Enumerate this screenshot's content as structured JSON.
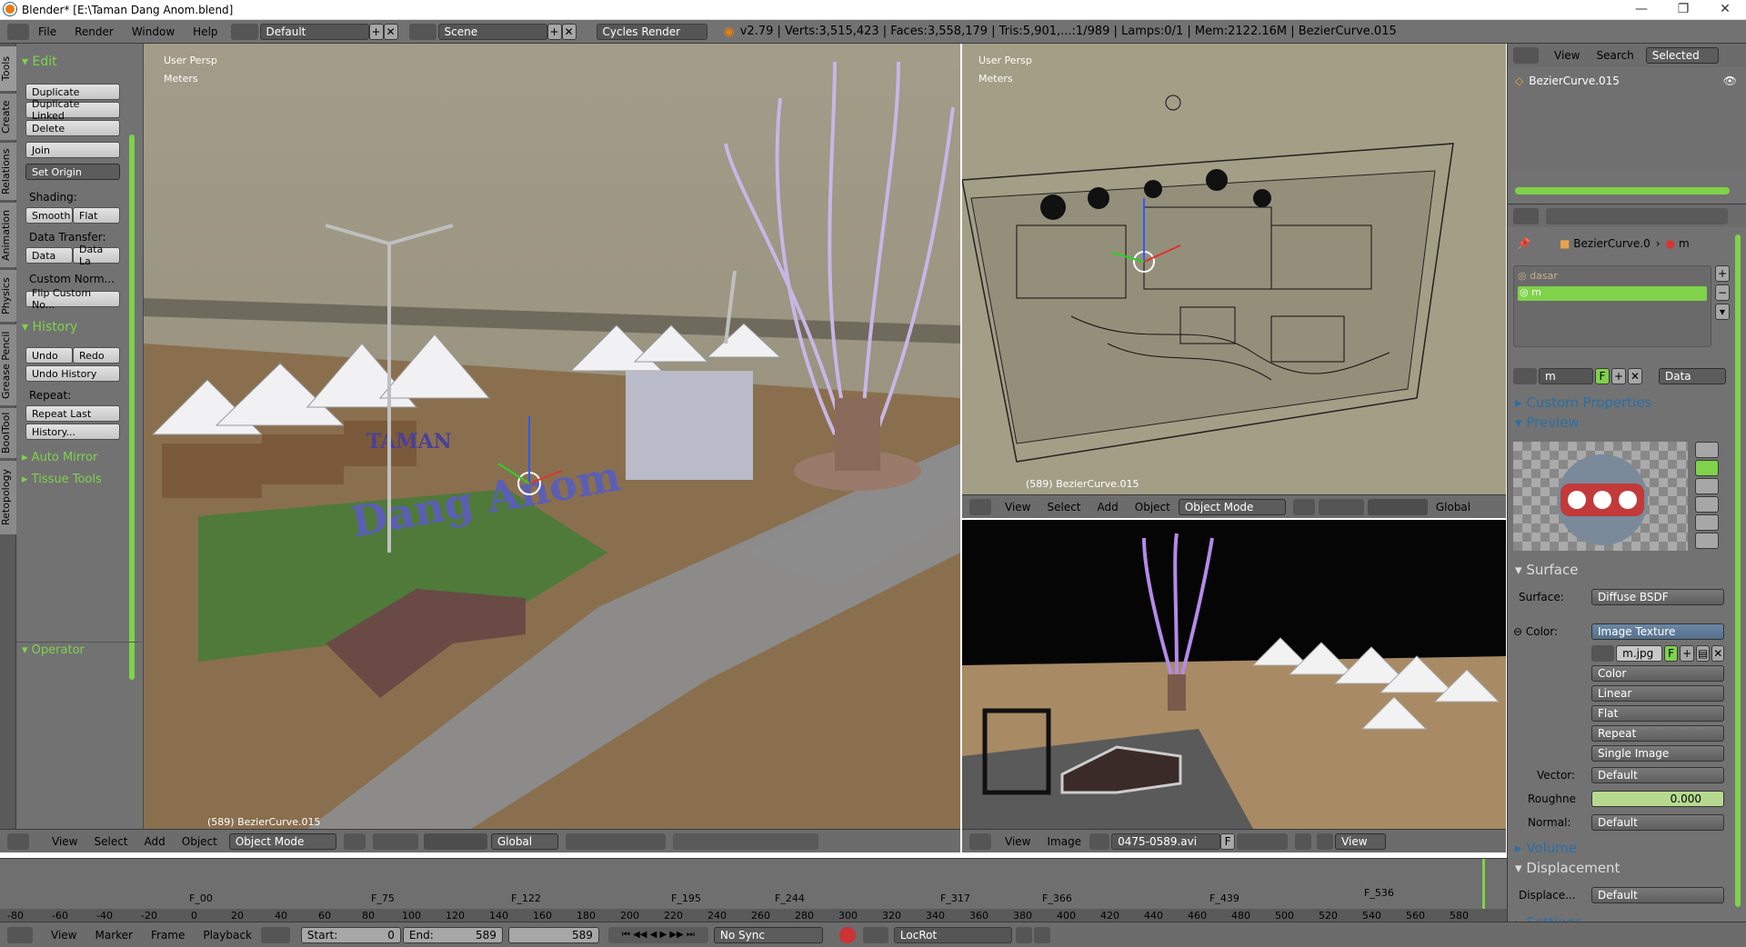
{
  "window": {
    "title": "Blender* [E:\\Taman Dang Anom.blend]",
    "min": "—",
    "max": "❐",
    "close": "✕"
  },
  "topbar": {
    "menus": [
      "File",
      "Render",
      "Window",
      "Help"
    ],
    "layout": "Default",
    "scene": "Scene",
    "engine": "Cycles Render",
    "stats": "v2.79 | Verts:3,515,423 | Faces:3,558,179 | Tris:5,901,...:1/989 | Lamps:0/1 | Mem:2122.16M | BezierCurve.015"
  },
  "tool_tabs": [
    "Tools",
    "Create",
    "Relations",
    "Animation",
    "Physics",
    "Grease Pencil",
    "BoolTool",
    "Retopology"
  ],
  "tool_panel": {
    "edit_header": "Edit",
    "duplicate": "Duplicate",
    "duplicate_linked": "Duplicate Linked",
    "delete": "Delete",
    "join": "Join",
    "set_origin": "Set Origin",
    "shading_label": "Shading:",
    "smooth": "Smooth",
    "flat": "Flat",
    "data_transfer_label": "Data Transfer:",
    "data": "Data",
    "data_la": "Data La",
    "custom_norm": "Custom Norm...",
    "flip_custom": "Flip Custom No...",
    "history_header": "History",
    "undo": "Undo",
    "redo": "Redo",
    "undo_history": "Undo History",
    "repeat_label": "Repeat:",
    "repeat_last": "Repeat Last",
    "history_btn": "History...",
    "auto_mirror": "Auto Mirror",
    "tissue_tools": "Tissue Tools",
    "operator_header": "Operator"
  },
  "viewport_left": {
    "persp": "User Persp",
    "units": "Meters",
    "object_label": "(589) BezierCurve.015",
    "sign_top": "TAMAN",
    "sign_main": "Dang Anom",
    "header": {
      "menus": [
        "View",
        "Select",
        "Add",
        "Object"
      ],
      "mode": "Object Mode",
      "orientation": "Global"
    }
  },
  "viewport_right_top": {
    "persp": "User Persp",
    "units": "Meters",
    "object_label": "(589) BezierCurve.015",
    "header": {
      "menus": [
        "View",
        "Select",
        "Add",
        "Object"
      ],
      "mode": "Object Mode",
      "orientation": "Global"
    }
  },
  "image_editor": {
    "header": {
      "menus": [
        "View",
        "Image"
      ],
      "image_name": "0475-0589.avi",
      "f": "F",
      "view": "View"
    }
  },
  "outliner": {
    "menus": [
      "View",
      "Search"
    ],
    "filter": "Selected",
    "item": "BezierCurve.015"
  },
  "properties": {
    "breadcrumb_object": "BezierCurve.0",
    "breadcrumb_material": "m",
    "materials": [
      "dasar",
      "m"
    ],
    "material_field": "m",
    "f": "F",
    "data_select": "Data",
    "custom_props": "Custom Properties",
    "preview": "Preview",
    "surface_header": "Surface",
    "surface_label": "Surface:",
    "surface_value": "Diffuse BSDF",
    "color_label": "Color:",
    "color_value": "Image Texture",
    "image_file": "m.jpg",
    "color_space": "Color",
    "interpolation": "Linear",
    "projection": "Flat",
    "extension": "Repeat",
    "source": "Single Image",
    "vector_label": "Vector:",
    "vector_value": "Default",
    "roughness_label": "Roughne",
    "roughness_value": "0.000",
    "normal_label": "Normal:",
    "normal_value": "Default",
    "volume_header": "Volume",
    "displacement_header": "Displacement",
    "displace_label": "Displace...",
    "displace_value": "Default",
    "settings_header": "Settings"
  },
  "timeline": {
    "markers": [
      "F_00",
      "F_75",
      "F_122",
      "F_195",
      "F_244",
      "F_317",
      "F_366",
      "F_439",
      "F_536"
    ],
    "ticks": [
      "-80",
      "-60",
      "-40",
      "-20",
      "0",
      "20",
      "40",
      "60",
      "80",
      "100",
      "120",
      "140",
      "160",
      "180",
      "200",
      "220",
      "240",
      "260",
      "280",
      "300",
      "320",
      "340",
      "360",
      "380",
      "400",
      "420",
      "440",
      "460",
      "480",
      "500",
      "520",
      "540",
      "560",
      "580"
    ]
  },
  "bottombar": {
    "menus": [
      "View",
      "Marker",
      "Frame",
      "Playback"
    ],
    "start_label": "Start:",
    "start_value": "0",
    "end_label": "End:",
    "end_value": "589",
    "current": "589",
    "sync": "No Sync",
    "keyset": "LocRot"
  },
  "colors": {
    "accent_green": "#7fd24a",
    "panel": "#727272",
    "header": "#6c6c6c"
  }
}
